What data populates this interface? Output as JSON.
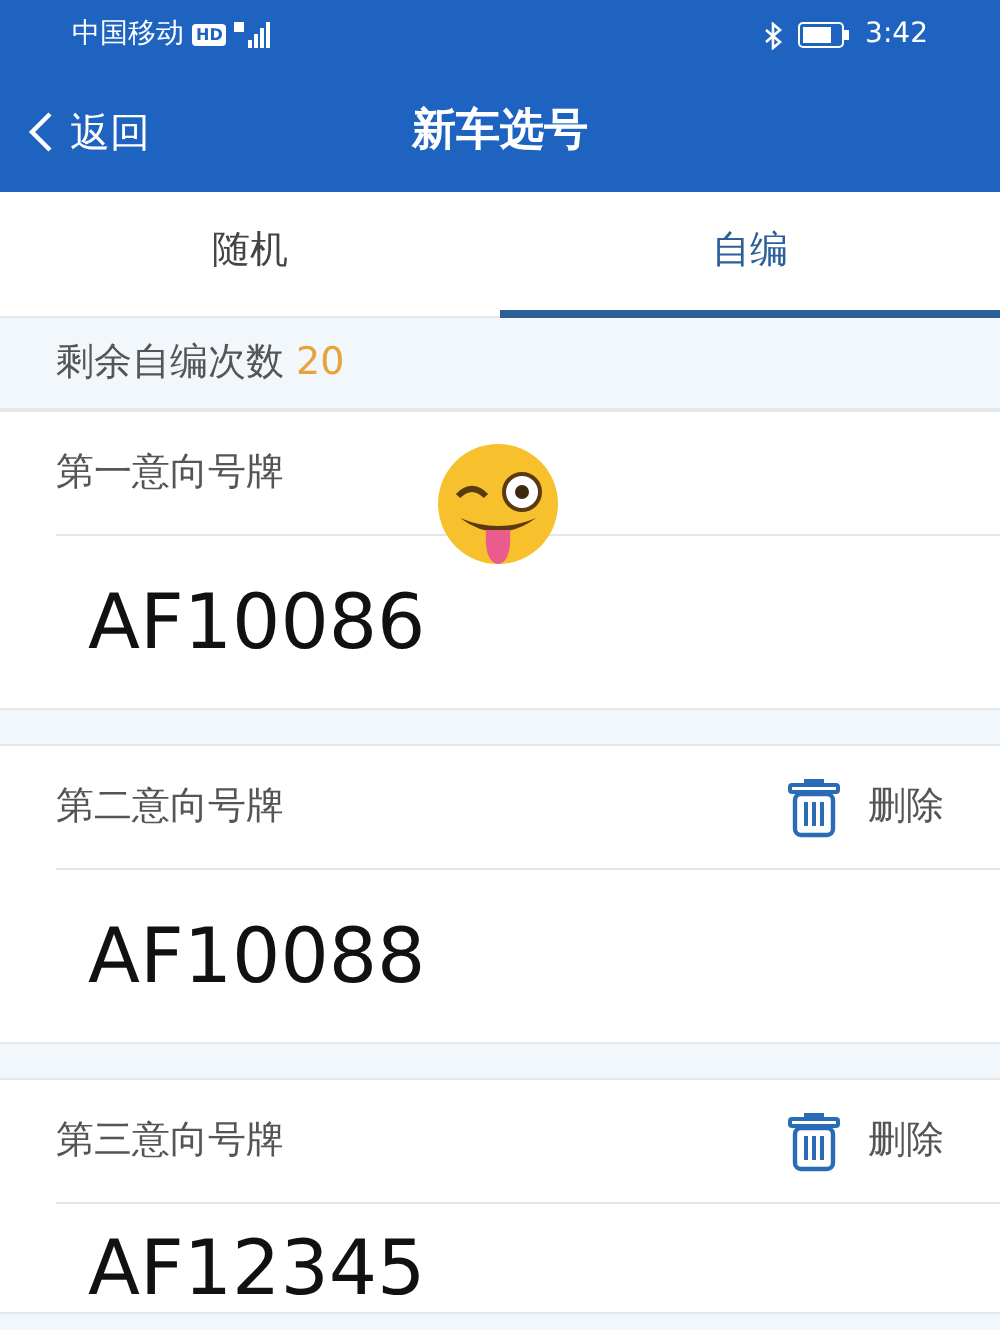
{
  "status_bar": {
    "carrier": "中国移动",
    "hd_badge": "HD",
    "time": "3:42"
  },
  "header": {
    "back_label": "返回",
    "title": "新车选号"
  },
  "tabs": [
    {
      "label": "随机",
      "selected": false
    },
    {
      "label": "自编",
      "selected": true
    }
  ],
  "remaining": {
    "label": "剩余自编次数",
    "count": "20"
  },
  "plates": [
    {
      "label": "第一意向号牌",
      "number": "AF10086",
      "deletable": false
    },
    {
      "label": "第二意向号牌",
      "number": "AF10088",
      "deletable": true,
      "delete_label": "删除"
    },
    {
      "label": "第三意向号牌",
      "number": "AF12345",
      "deletable": true,
      "delete_label": "删除"
    }
  ]
}
